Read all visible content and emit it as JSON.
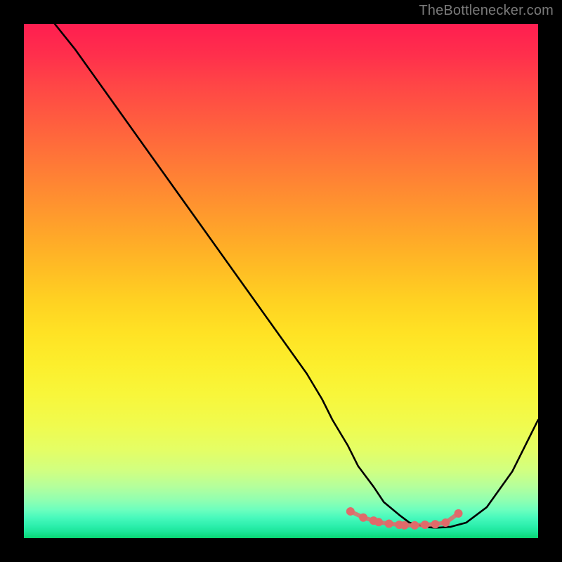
{
  "watermark": "TheBottlenecker.com",
  "chart_data": {
    "type": "line",
    "title": "",
    "xlabel": "",
    "ylabel": "",
    "xlim": [
      0,
      100
    ],
    "ylim": [
      0,
      100
    ],
    "series": [
      {
        "name": "curve",
        "x": [
          6,
          10,
          15,
          20,
          25,
          30,
          35,
          40,
          45,
          50,
          55,
          58,
          60,
          63,
          65,
          68,
          70,
          73,
          75,
          78,
          80,
          83,
          86,
          90,
          95,
          100
        ],
        "y": [
          100,
          95,
          88,
          81,
          74,
          67,
          60,
          53,
          46,
          39,
          32,
          27,
          23,
          18,
          14,
          10,
          7,
          4.5,
          3,
          2.2,
          2,
          2.2,
          3,
          6,
          13,
          23
        ]
      }
    ],
    "markers": {
      "name": "bottom-dots",
      "x": [
        63.5,
        66,
        68,
        69,
        71,
        73,
        74,
        76,
        78,
        80,
        82,
        84.5
      ],
      "y": [
        5.2,
        4.0,
        3.4,
        3.1,
        2.8,
        2.6,
        2.5,
        2.5,
        2.6,
        2.7,
        3.0,
        4.8
      ],
      "color": "#e06a6a",
      "radius": 6
    },
    "colors": {
      "curve": "#000000",
      "marker": "#e06a6a"
    }
  }
}
